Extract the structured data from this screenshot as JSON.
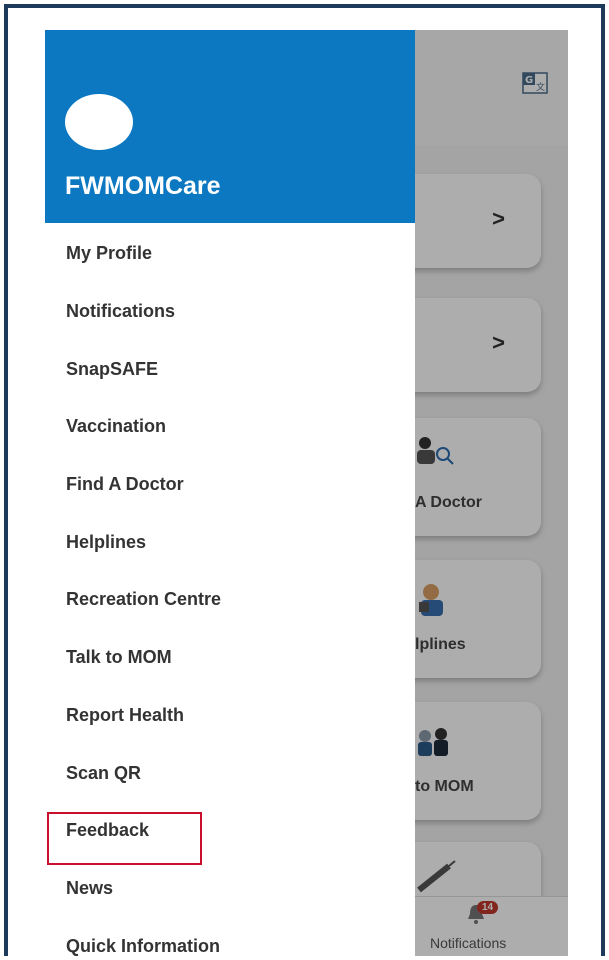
{
  "drawer": {
    "app_name": "FWMOMCare",
    "menu": [
      "My Profile",
      "Notifications",
      "SnapSAFE",
      "Vaccination",
      "Find A Doctor",
      "Helplines",
      "Recreation Centre",
      "Talk to MOM",
      "Report Health",
      "Scan QR",
      "Feedback",
      "News",
      "Quick Information"
    ],
    "highlighted_item": "Feedback"
  },
  "background": {
    "cards": [
      {
        "label": "A Doctor"
      },
      {
        "label": "lplines"
      },
      {
        "label": "to MOM"
      }
    ],
    "bottom_nav": {
      "label": "Notifications",
      "badge": "14"
    }
  },
  "colors": {
    "header": "#0b78c1",
    "highlight_border": "#c8102e",
    "frame": "#1e3a5a"
  }
}
